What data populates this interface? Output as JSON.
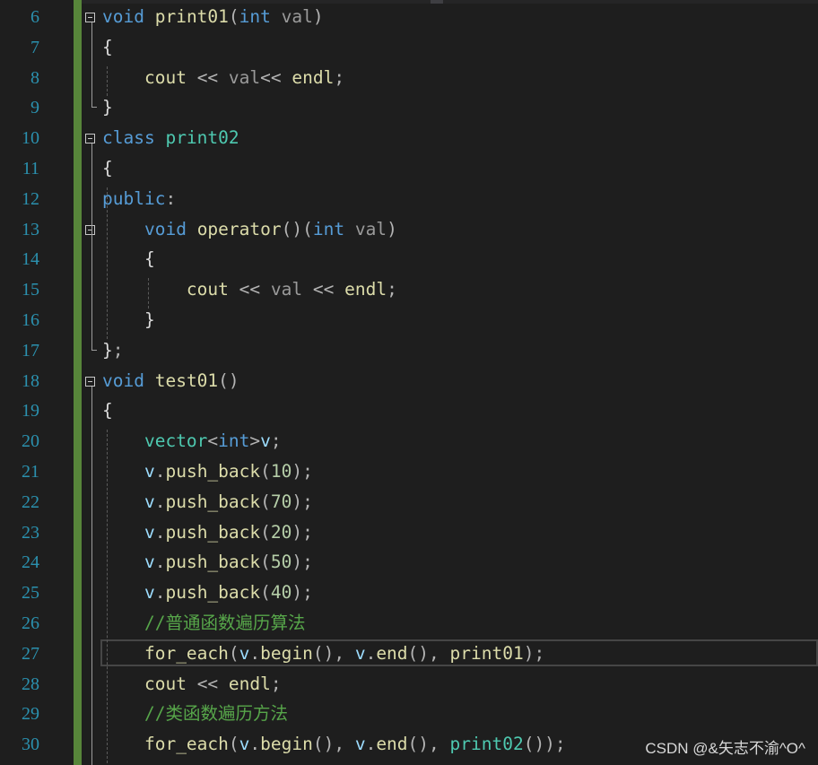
{
  "editor": {
    "lines": [
      {
        "n": "6",
        "segs": [
          [
            "kw",
            "void"
          ],
          [
            "txt",
            " "
          ],
          [
            "fn",
            "print01"
          ],
          [
            "punc",
            "("
          ],
          [
            "kw",
            "int"
          ],
          [
            "txt",
            " "
          ],
          [
            "param",
            "val"
          ],
          [
            "punc",
            ")"
          ]
        ]
      },
      {
        "n": "7",
        "segs": [
          [
            "txt",
            "{"
          ]
        ]
      },
      {
        "n": "8",
        "segs": [
          [
            "txt",
            "    "
          ],
          [
            "fn",
            "cout"
          ],
          [
            "txt",
            " "
          ],
          [
            "punc",
            "<<"
          ],
          [
            "txt",
            " "
          ],
          [
            "param",
            "val"
          ],
          [
            "punc",
            "<<"
          ],
          [
            "txt",
            " "
          ],
          [
            "fn",
            "endl"
          ],
          [
            "punc",
            ";"
          ]
        ]
      },
      {
        "n": "9",
        "segs": [
          [
            "txt",
            "}"
          ]
        ]
      },
      {
        "n": "10",
        "segs": [
          [
            "kw",
            "class"
          ],
          [
            "txt",
            " "
          ],
          [
            "ty",
            "print02"
          ]
        ]
      },
      {
        "n": "11",
        "segs": [
          [
            "txt",
            "{"
          ]
        ]
      },
      {
        "n": "12",
        "segs": [
          [
            "kw",
            "public"
          ],
          [
            "punc",
            ":"
          ]
        ]
      },
      {
        "n": "13",
        "segs": [
          [
            "txt",
            "    "
          ],
          [
            "kw",
            "void"
          ],
          [
            "txt",
            " "
          ],
          [
            "fn",
            "operator"
          ],
          [
            "punc",
            "()("
          ],
          [
            "kw",
            "int"
          ],
          [
            "txt",
            " "
          ],
          [
            "param",
            "val"
          ],
          [
            "punc",
            ")"
          ]
        ]
      },
      {
        "n": "14",
        "segs": [
          [
            "txt",
            "    {"
          ]
        ]
      },
      {
        "n": "15",
        "segs": [
          [
            "txt",
            "        "
          ],
          [
            "fn",
            "cout"
          ],
          [
            "txt",
            " "
          ],
          [
            "punc",
            "<<"
          ],
          [
            "txt",
            " "
          ],
          [
            "param",
            "val"
          ],
          [
            "txt",
            " "
          ],
          [
            "punc",
            "<<"
          ],
          [
            "txt",
            " "
          ],
          [
            "fn",
            "endl"
          ],
          [
            "punc",
            ";"
          ]
        ]
      },
      {
        "n": "16",
        "segs": [
          [
            "txt",
            "    }"
          ]
        ]
      },
      {
        "n": "17",
        "segs": [
          [
            "txt",
            "}"
          ],
          [
            "punc",
            ";"
          ]
        ]
      },
      {
        "n": "18",
        "segs": [
          [
            "kw",
            "void"
          ],
          [
            "txt",
            " "
          ],
          [
            "fn",
            "test01"
          ],
          [
            "punc",
            "()"
          ]
        ]
      },
      {
        "n": "19",
        "segs": [
          [
            "txt",
            "{"
          ]
        ]
      },
      {
        "n": "20",
        "segs": [
          [
            "txt",
            "    "
          ],
          [
            "ty",
            "vector"
          ],
          [
            "punc",
            "<"
          ],
          [
            "kw",
            "int"
          ],
          [
            "punc",
            ">"
          ],
          [
            "var",
            "v"
          ],
          [
            "punc",
            ";"
          ]
        ]
      },
      {
        "n": "21",
        "segs": [
          [
            "txt",
            "    "
          ],
          [
            "var",
            "v"
          ],
          [
            "punc",
            "."
          ],
          [
            "fn",
            "push_back"
          ],
          [
            "punc",
            "("
          ],
          [
            "num",
            "10"
          ],
          [
            "punc",
            ");"
          ]
        ]
      },
      {
        "n": "22",
        "segs": [
          [
            "txt",
            "    "
          ],
          [
            "var",
            "v"
          ],
          [
            "punc",
            "."
          ],
          [
            "fn",
            "push_back"
          ],
          [
            "punc",
            "("
          ],
          [
            "num",
            "70"
          ],
          [
            "punc",
            ");"
          ]
        ]
      },
      {
        "n": "23",
        "segs": [
          [
            "txt",
            "    "
          ],
          [
            "var",
            "v"
          ],
          [
            "punc",
            "."
          ],
          [
            "fn",
            "push_back"
          ],
          [
            "punc",
            "("
          ],
          [
            "num",
            "20"
          ],
          [
            "punc",
            ");"
          ]
        ]
      },
      {
        "n": "24",
        "segs": [
          [
            "txt",
            "    "
          ],
          [
            "var",
            "v"
          ],
          [
            "punc",
            "."
          ],
          [
            "fn",
            "push_back"
          ],
          [
            "punc",
            "("
          ],
          [
            "num",
            "50"
          ],
          [
            "punc",
            ");"
          ]
        ]
      },
      {
        "n": "25",
        "segs": [
          [
            "txt",
            "    "
          ],
          [
            "var",
            "v"
          ],
          [
            "punc",
            "."
          ],
          [
            "fn",
            "push_back"
          ],
          [
            "punc",
            "("
          ],
          [
            "num",
            "40"
          ],
          [
            "punc",
            ");"
          ]
        ]
      },
      {
        "n": "26",
        "segs": [
          [
            "txt",
            "    "
          ],
          [
            "cm",
            "//普通函数遍历算法"
          ]
        ]
      },
      {
        "n": "27",
        "segs": [
          [
            "txt",
            "    "
          ],
          [
            "fn",
            "for_each"
          ],
          [
            "punc",
            "("
          ],
          [
            "var",
            "v"
          ],
          [
            "punc",
            "."
          ],
          [
            "fn",
            "begin"
          ],
          [
            "punc",
            "(), "
          ],
          [
            "var",
            "v"
          ],
          [
            "punc",
            "."
          ],
          [
            "fn",
            "end"
          ],
          [
            "punc",
            "(), "
          ],
          [
            "fn",
            "print01"
          ],
          [
            "punc",
            ");"
          ]
        ]
      },
      {
        "n": "28",
        "segs": [
          [
            "txt",
            "    "
          ],
          [
            "fn",
            "cout"
          ],
          [
            "txt",
            " "
          ],
          [
            "punc",
            "<<"
          ],
          [
            "txt",
            " "
          ],
          [
            "fn",
            "endl"
          ],
          [
            "punc",
            ";"
          ]
        ]
      },
      {
        "n": "29",
        "segs": [
          [
            "txt",
            "    "
          ],
          [
            "cm",
            "//类函数遍历方法"
          ]
        ]
      },
      {
        "n": "30",
        "segs": [
          [
            "txt",
            "    "
          ],
          [
            "fn",
            "for_each"
          ],
          [
            "punc",
            "("
          ],
          [
            "var",
            "v"
          ],
          [
            "punc",
            "."
          ],
          [
            "fn",
            "begin"
          ],
          [
            "punc",
            "(), "
          ],
          [
            "var",
            "v"
          ],
          [
            "punc",
            "."
          ],
          [
            "fn",
            "end"
          ],
          [
            "punc",
            "(), "
          ],
          [
            "ty",
            "print02"
          ],
          [
            "punc",
            "());"
          ]
        ]
      }
    ]
  },
  "watermark": "CSDN @&矢志不渝^O^",
  "colors": {
    "background": "#1e1e1e",
    "line_number": "#2b91af",
    "keyword": "#569cd6",
    "function": "#dcdcaa",
    "type": "#4ec9b0",
    "number": "#b5cea8",
    "comment": "#57a64a",
    "variable": "#9cdcfe",
    "change_bar": "#57853a"
  }
}
